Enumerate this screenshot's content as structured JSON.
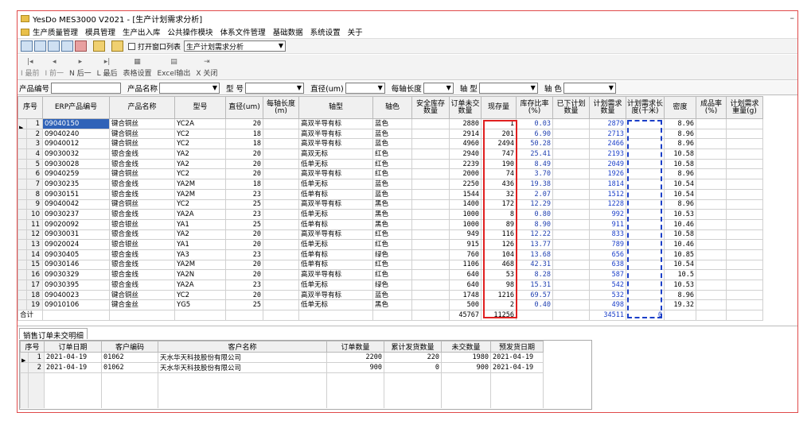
{
  "window": {
    "title": "YesDo MES3000 V2021 - [生产计划需求分析]",
    "close_glyph": "–"
  },
  "menu": {
    "items": [
      "生产质量管理",
      "模具管理",
      "生产出入库",
      "公共操作模块",
      "体系文件管理",
      "基础数据",
      "系统设置",
      "关于"
    ]
  },
  "toolbar": {
    "open_list_label": "打开窗口列表",
    "window_select_value": "生产计划需求分析"
  },
  "nav": {
    "first": "I 最前",
    "prev": "I 前一",
    "next": "N 后一",
    "last": "L 最后",
    "table_settings": "表格设置",
    "excel_export": "Excel输出",
    "close": "X 关闭"
  },
  "filters": {
    "product_code": "产品编号",
    "product_name": "产品名称",
    "model": "型 号",
    "diameter": "直径(um)",
    "reel_length": "每轴长度",
    "reel_type": "轴 型",
    "reel_color": "轴 色"
  },
  "grid": {
    "headers": {
      "seq": "序号",
      "erp": "ERP产品编号",
      "name": "产品名称",
      "model": "型号",
      "diameter": "直径(um)",
      "reel_len": "每轴长度(m)",
      "reel_type": "轴型",
      "reel_color": "轴色",
      "safety_stock": "安全库存数量",
      "unfinished": "订单未交数量",
      "stock": "现存量",
      "stock_ratio": "库存比率(%)",
      "planned": "已下计划数量",
      "demand": "计划需求数量",
      "demand_len": "计划需求长度(千米)",
      "density": "密度",
      "yield": "成品率(%)",
      "demand_weight": "计划需求重量(g)"
    },
    "rows": [
      {
        "seq": "1",
        "erp": "09040150",
        "name": "键合铜丝",
        "model": "YC2A",
        "diameter": "20",
        "reel_type": "高双半导有标",
        "reel_color": "蓝色",
        "unfinished": "2880",
        "stock": "1",
        "ratio": "0.03",
        "demand": "2879",
        "density": "8.96"
      },
      {
        "seq": "2",
        "erp": "09040240",
        "name": "键合铜丝",
        "model": "YC2",
        "diameter": "18",
        "reel_type": "高双半导有标",
        "reel_color": "蓝色",
        "unfinished": "2914",
        "stock": "201",
        "ratio": "6.90",
        "demand": "2713",
        "density": "8.96"
      },
      {
        "seq": "3",
        "erp": "09040012",
        "name": "键合铜丝",
        "model": "YC2",
        "diameter": "18",
        "reel_type": "高双半导有标",
        "reel_color": "蓝色",
        "unfinished": "4960",
        "stock": "2494",
        "ratio": "50.28",
        "demand": "2466",
        "density": "8.96"
      },
      {
        "seq": "4",
        "erp": "09030032",
        "name": "银合金线",
        "model": "YA2",
        "diameter": "20",
        "reel_type": "高双无标",
        "reel_color": "红色",
        "unfinished": "2940",
        "stock": "747",
        "ratio": "25.41",
        "demand": "2193",
        "density": "10.58"
      },
      {
        "seq": "5",
        "erp": "09030028",
        "name": "银合金线",
        "model": "YA2",
        "diameter": "20",
        "reel_type": "低单无标",
        "reel_color": "红色",
        "unfinished": "2239",
        "stock": "190",
        "ratio": "8.49",
        "demand": "2049",
        "density": "10.58"
      },
      {
        "seq": "6",
        "erp": "09040259",
        "name": "键合铜丝",
        "model": "YC2",
        "diameter": "20",
        "reel_type": "高双半导有标",
        "reel_color": "红色",
        "unfinished": "2000",
        "stock": "74",
        "ratio": "3.70",
        "demand": "1926",
        "density": "8.96"
      },
      {
        "seq": "7",
        "erp": "09030235",
        "name": "银合金线",
        "model": "YA2M",
        "diameter": "18",
        "reel_type": "低单无标",
        "reel_color": "蓝色",
        "unfinished": "2250",
        "stock": "436",
        "ratio": "19.38",
        "demand": "1814",
        "density": "10.54"
      },
      {
        "seq": "8",
        "erp": "09030151",
        "name": "银合金线",
        "model": "YA2M",
        "diameter": "23",
        "reel_type": "低单有标",
        "reel_color": "蓝色",
        "unfinished": "1544",
        "stock": "32",
        "ratio": "2.07",
        "demand": "1512",
        "density": "10.54"
      },
      {
        "seq": "9",
        "erp": "09040042",
        "name": "键合铜丝",
        "model": "YC2",
        "diameter": "25",
        "reel_type": "高双半导有标",
        "reel_color": "黑色",
        "unfinished": "1400",
        "stock": "172",
        "ratio": "12.29",
        "demand": "1228",
        "density": "8.96"
      },
      {
        "seq": "10",
        "erp": "09030237",
        "name": "银合金线",
        "model": "YA2A",
        "diameter": "23",
        "reel_type": "低单无标",
        "reel_color": "黑色",
        "unfinished": "1000",
        "stock": "8",
        "ratio": "0.80",
        "demand": "992",
        "density": "10.53"
      },
      {
        "seq": "11",
        "erp": "09020092",
        "name": "银合银丝",
        "model": "YA1",
        "diameter": "25",
        "reel_type": "低单有标",
        "reel_color": "黑色",
        "unfinished": "1000",
        "stock": "89",
        "ratio": "8.90",
        "demand": "911",
        "density": "10.46"
      },
      {
        "seq": "12",
        "erp": "09030031",
        "name": "银合金线",
        "model": "YA2",
        "diameter": "20",
        "reel_type": "高双半导有标",
        "reel_color": "红色",
        "unfinished": "949",
        "stock": "116",
        "ratio": "12.22",
        "demand": "833",
        "density": "10.58"
      },
      {
        "seq": "13",
        "erp": "09020024",
        "name": "银合银丝",
        "model": "YA1",
        "diameter": "20",
        "reel_type": "低单无标",
        "reel_color": "红色",
        "unfinished": "915",
        "stock": "126",
        "ratio": "13.77",
        "demand": "789",
        "density": "10.46"
      },
      {
        "seq": "14",
        "erp": "09030405",
        "name": "银合金线",
        "model": "YA3",
        "diameter": "23",
        "reel_type": "低单有标",
        "reel_color": "绿色",
        "unfinished": "760",
        "stock": "104",
        "ratio": "13.68",
        "demand": "656",
        "density": "10.85"
      },
      {
        "seq": "15",
        "erp": "09030146",
        "name": "银合金线",
        "model": "YA2M",
        "diameter": "20",
        "reel_type": "低单有标",
        "reel_color": "红色",
        "unfinished": "1106",
        "stock": "468",
        "ratio": "42.31",
        "demand": "638",
        "density": "10.54"
      },
      {
        "seq": "16",
        "erp": "09030329",
        "name": "银合金线",
        "model": "YA2N",
        "diameter": "20",
        "reel_type": "高双半导有标",
        "reel_color": "红色",
        "unfinished": "640",
        "stock": "53",
        "ratio": "8.28",
        "demand": "587",
        "density": "10.5"
      },
      {
        "seq": "17",
        "erp": "09030395",
        "name": "银合金线",
        "model": "YA2A",
        "diameter": "23",
        "reel_type": "低单无标",
        "reel_color": "绿色",
        "unfinished": "640",
        "stock": "98",
        "ratio": "15.31",
        "demand": "542",
        "density": "10.53"
      },
      {
        "seq": "18",
        "erp": "09040023",
        "name": "键合铜丝",
        "model": "YC2",
        "diameter": "20",
        "reel_type": "高双半导有标",
        "reel_color": "蓝色",
        "unfinished": "1748",
        "stock": "1216",
        "ratio": "69.57",
        "demand": "532",
        "density": "8.96"
      },
      {
        "seq": "19",
        "erp": "09010106",
        "name": "键合金丝",
        "model": "YG5",
        "diameter": "25",
        "reel_type": "低单无标",
        "reel_color": "黑色",
        "unfinished": "500",
        "stock": "2",
        "ratio": "0.40",
        "demand": "498",
        "density": "19.32"
      }
    ],
    "totals": {
      "label": "合计",
      "unfinished": "45767",
      "stock": "11256",
      "demand": "34511",
      "demand_len": "0"
    }
  },
  "detail": {
    "tab_label": "销售订单未交明细",
    "headers": {
      "seq": "序号",
      "order_date": "订单日期",
      "customer_code": "客户编码",
      "customer_name": "客户名称",
      "order_qty": "订单数量",
      "shipped": "累计发货数量",
      "unfinished": "未交数量",
      "planned_ship": "预发货日期"
    },
    "rows": [
      {
        "seq": "1",
        "order_date": "2021-04-19",
        "customer_code": "01062",
        "customer_name": "天水华天科技股份有限公司",
        "order_qty": "2200",
        "shipped": "220",
        "unfinished": "1980",
        "planned_ship": "2021-04-19"
      },
      {
        "seq": "2",
        "order_date": "2021-04-19",
        "customer_code": "01062",
        "customer_name": "天水华天科技股份有限公司",
        "order_qty": "900",
        "shipped": "0",
        "unfinished": "900",
        "planned_ship": "2021-04-19"
      }
    ]
  }
}
